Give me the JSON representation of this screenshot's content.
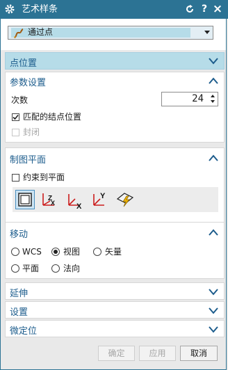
{
  "window": {
    "title": "艺术样条",
    "reset_icon": "refresh-icon",
    "help_label": "?",
    "close_label": "×"
  },
  "type_select": {
    "value": "通过点"
  },
  "sections": {
    "point_position": {
      "title": "点位置"
    },
    "params": {
      "title": "参数设置",
      "degree_label": "次数",
      "degree_value": "24",
      "match_knots_label": "匹配的结点位置",
      "match_knots_checked": true,
      "closed_label": "封闭",
      "closed_checked": false
    },
    "plane": {
      "title": "制图平面",
      "constrain_label": "约束到平面",
      "constrain_checked": false,
      "tools": [
        "view-plane-icon",
        "xc-plane-icon",
        "yz-plane-icon",
        "xy-plane-icon",
        "plane-dialog-icon"
      ]
    },
    "move": {
      "title": "移动",
      "options": [
        {
          "label": "WCS",
          "selected": false
        },
        {
          "label": "视图",
          "selected": true
        },
        {
          "label": "矢量",
          "selected": false
        },
        {
          "label": "平面",
          "selected": false
        },
        {
          "label": "法向",
          "selected": false
        }
      ]
    },
    "extend": {
      "title": "延伸"
    },
    "settings": {
      "title": "设置"
    },
    "fine_tune": {
      "title": "微定位"
    }
  },
  "buttons": {
    "ok": "确定",
    "apply": "应用",
    "cancel": "取消"
  },
  "colors": {
    "titlebar": "#2c7394",
    "section_title": "#1c5c8c",
    "highlight": "#b6dce8"
  }
}
